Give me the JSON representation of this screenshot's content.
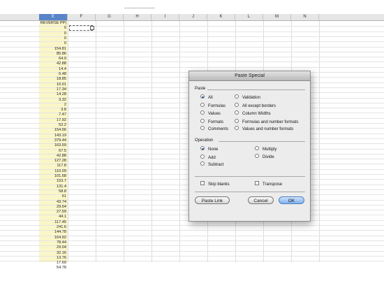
{
  "spreadsheet": {
    "columns": [
      "E",
      "F",
      "G",
      "H",
      "I",
      "J",
      "K",
      "L",
      "M",
      "N"
    ],
    "selected_column": "E",
    "column_e_header": "REVERSE PP(",
    "column_e_values": [
      "0",
      "0",
      "0",
      "0",
      "154.81",
      "85.86",
      "64.9",
      "42.88",
      "14.4",
      "6.48",
      "18.85",
      "10.01",
      "17.34",
      "14.28",
      "3.32",
      "2",
      "3.8",
      "7.47",
      "17.92",
      "52.2",
      "154.56",
      "143.19",
      "379.44",
      "163.59",
      "67.5",
      "42.88",
      "127.28",
      "117.8",
      "110.09",
      "101.68",
      "153.7",
      "131.4",
      "58.8",
      "51",
      "43.74",
      "29.64",
      "27.59",
      "44.1",
      "117.45",
      "241.6",
      "144.78",
      "164.92",
      "78.44",
      "29.04",
      "32.16",
      "13.76",
      "17.69",
      "54.78"
    ]
  },
  "dialog": {
    "title": "Paste Special",
    "paste_section": "Paste",
    "paste_options_left": [
      "All",
      "Formulas",
      "Values",
      "Formats",
      "Comments"
    ],
    "paste_options_right": [
      "Validation",
      "All except borders",
      "Column Widths",
      "Formulas and number formats",
      "Values and number formats"
    ],
    "paste_selected": "All",
    "operation_section": "Operation",
    "operation_left": [
      "None",
      "Add",
      "Subtract"
    ],
    "operation_right": [
      "Multiply",
      "Divide"
    ],
    "operation_selected": "None",
    "skip_blanks": "Skip blanks",
    "transpose": "Transpose",
    "paste_link_button": "Paste Link",
    "cancel_button": "Cancel",
    "ok_button": "OK"
  }
}
